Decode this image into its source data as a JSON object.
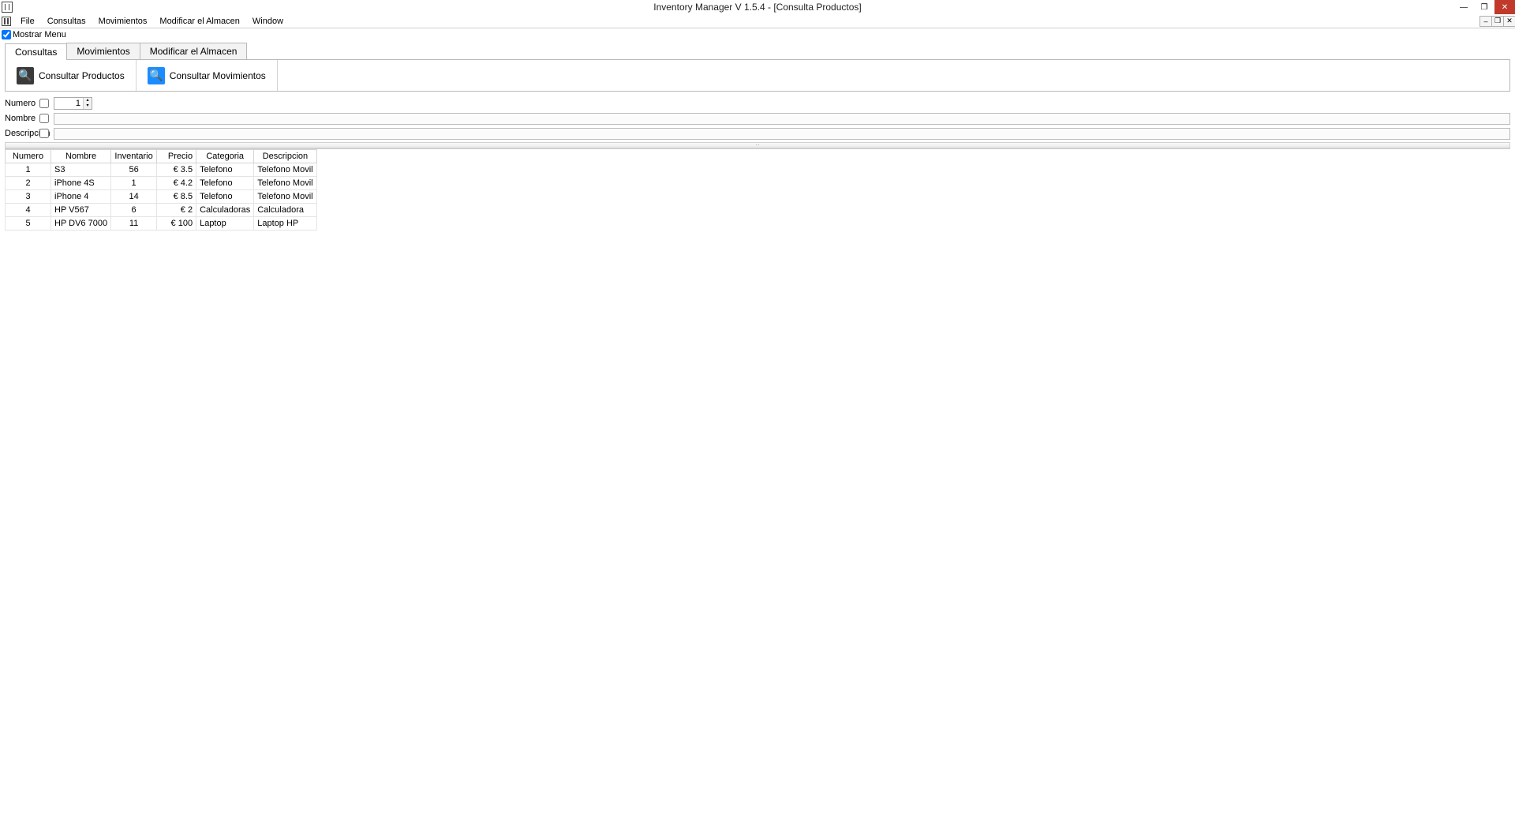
{
  "window": {
    "title": "Inventory Manager V 1.5.4 - [Consulta Productos]",
    "minimize": "—",
    "maximize": "❐",
    "close": "✕"
  },
  "menubar": {
    "items": [
      "File",
      "Consultas",
      "Movimientos",
      "Modificar el Almacen",
      "Window"
    ],
    "mdi_minimize": "‒",
    "mdi_restore": "❐",
    "mdi_close": "✕"
  },
  "showmenu": {
    "label": "Mostrar Menu",
    "checked": true
  },
  "primary_tabs": {
    "items": [
      "Consultas",
      "Movimientos",
      "Modificar el Almacen"
    ],
    "active_index": 0
  },
  "ribbon": {
    "buttons": [
      {
        "label": "Consultar Productos",
        "icon": "search-dark"
      },
      {
        "label": "Consultar Movimientos",
        "icon": "search-blue"
      }
    ]
  },
  "filters": {
    "numero": {
      "label": "Numero",
      "checked": false,
      "value": "1"
    },
    "nombre": {
      "label": "Nombre",
      "checked": false,
      "value": ""
    },
    "descripcion": {
      "label": "Descripcion",
      "checked": false,
      "value": ""
    }
  },
  "splitter_grip": "··",
  "table": {
    "headers": [
      "Numero",
      "Nombre",
      "Inventario",
      "Precio",
      "Categoria",
      "Descripcion"
    ],
    "rows": [
      {
        "numero": "1",
        "nombre": "S3",
        "inventario": "56",
        "precio": "€ 3.5",
        "categoria": "Telefono",
        "descripcion": "Telefono Movil"
      },
      {
        "numero": "2",
        "nombre": "iPhone 4S",
        "inventario": "1",
        "precio": "€ 4.2",
        "categoria": "Telefono",
        "descripcion": "Telefono Movil"
      },
      {
        "numero": "3",
        "nombre": "iPhone 4",
        "inventario": "14",
        "precio": "€ 8.5",
        "categoria": "Telefono",
        "descripcion": "Telefono Movil"
      },
      {
        "numero": "4",
        "nombre": "HP V567",
        "inventario": "6",
        "precio": "€ 2",
        "categoria": "Calculadoras",
        "descripcion": "Calculadora"
      },
      {
        "numero": "5",
        "nombre": "HP DV6 7000",
        "inventario": "11",
        "precio": "€ 100",
        "categoria": "Laptop",
        "descripcion": "Laptop HP"
      }
    ]
  }
}
